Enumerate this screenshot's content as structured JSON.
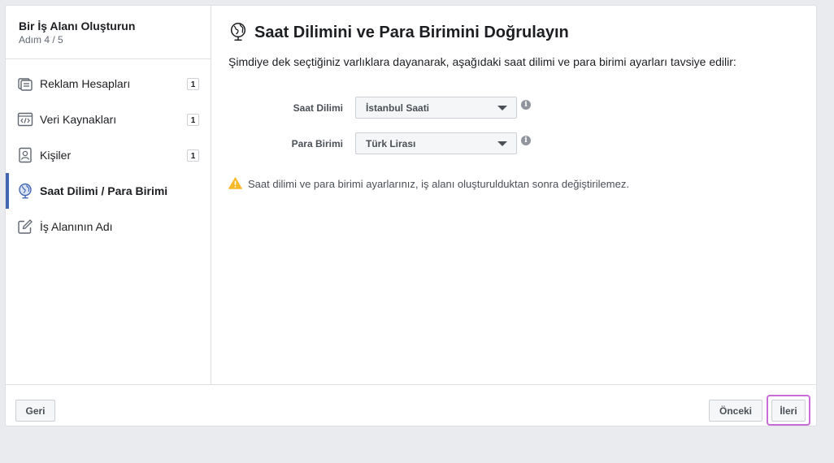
{
  "sidebar": {
    "title": "Bir İş Alanı Oluşturun",
    "step": "Adım 4 / 5",
    "items": [
      {
        "label": "Reklam Hesapları",
        "badge": "1",
        "icon": "ad-accounts-icon",
        "active": false
      },
      {
        "label": "Veri Kaynakları",
        "badge": "1",
        "icon": "code-window-icon",
        "active": false
      },
      {
        "label": "Kişiler",
        "badge": "1",
        "icon": "person-badge-icon",
        "active": false
      },
      {
        "label": "Saat Dilimi / Para Birimi",
        "badge": "",
        "icon": "globe-icon",
        "active": true
      },
      {
        "label": "İş Alanının Adı",
        "badge": "",
        "icon": "edit-icon",
        "active": false
      }
    ]
  },
  "main": {
    "title": "Saat Dilimini ve Para Birimini Doğrulayın",
    "description": "Şimdiye dek seçtiğiniz varlıklara dayanarak, aşağıdaki saat dilimi ve para birimi ayarları tavsiye edilir:",
    "timezone": {
      "label": "Saat Dilimi",
      "value": "İstanbul Saati"
    },
    "currency": {
      "label": "Para Birimi",
      "value": "Türk Lirası"
    },
    "warning": "Saat dilimi ve para birimi ayarlarınız, iş alanı oluşturulduktan sonra değiştirilemez."
  },
  "footer": {
    "back_label": "Geri",
    "prev_label": "Önceki",
    "next_label": "İleri"
  },
  "colors": {
    "accent": "#4267b2",
    "warning": "#f7b928",
    "highlight": "#c86dd7"
  }
}
